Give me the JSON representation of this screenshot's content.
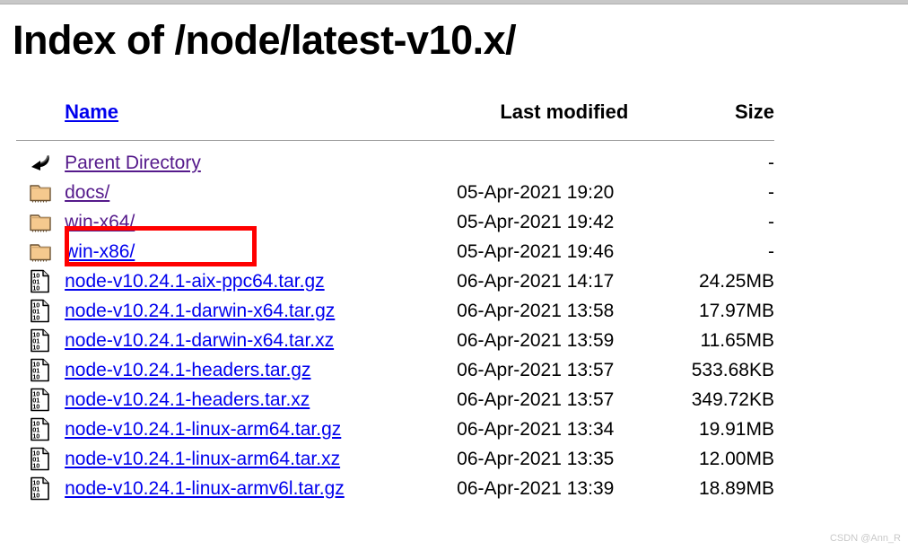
{
  "page": {
    "title": "Index of /node/latest-v10.x/"
  },
  "table": {
    "headers": {
      "name": "Name",
      "last_modified": "Last modified",
      "size": "Size"
    },
    "rows": [
      {
        "icon": "back-arrow-icon",
        "name": "Parent Directory",
        "date": "",
        "size": "-",
        "visited": true
      },
      {
        "icon": "folder-icon",
        "name": "docs/",
        "date": "05-Apr-2021 19:20",
        "size": "-",
        "visited": true
      },
      {
        "icon": "folder-icon",
        "name": "win-x64/",
        "date": "05-Apr-2021 19:42",
        "size": "-",
        "visited": true
      },
      {
        "icon": "folder-icon",
        "name": "win-x86/",
        "date": "05-Apr-2021 19:46",
        "size": "-",
        "visited": false
      },
      {
        "icon": "binary-file-icon",
        "name": "node-v10.24.1-aix-ppc64.tar.gz",
        "date": "06-Apr-2021 14:17",
        "size": "24.25MB",
        "visited": false
      },
      {
        "icon": "binary-file-icon",
        "name": "node-v10.24.1-darwin-x64.tar.gz",
        "date": "06-Apr-2021 13:58",
        "size": "17.97MB",
        "visited": false
      },
      {
        "icon": "binary-file-icon",
        "name": "node-v10.24.1-darwin-x64.tar.xz",
        "date": "06-Apr-2021 13:59",
        "size": "11.65MB",
        "visited": false
      },
      {
        "icon": "binary-file-icon",
        "name": "node-v10.24.1-headers.tar.gz",
        "date": "06-Apr-2021 13:57",
        "size": "533.68KB",
        "visited": false
      },
      {
        "icon": "binary-file-icon",
        "name": "node-v10.24.1-headers.tar.xz",
        "date": "06-Apr-2021 13:57",
        "size": "349.72KB",
        "visited": false
      },
      {
        "icon": "binary-file-icon",
        "name": "node-v10.24.1-linux-arm64.tar.gz",
        "date": "06-Apr-2021 13:34",
        "size": "19.91MB",
        "visited": false
      },
      {
        "icon": "binary-file-icon",
        "name": "node-v10.24.1-linux-arm64.tar.xz",
        "date": "06-Apr-2021 13:35",
        "size": "12.00MB",
        "visited": false
      },
      {
        "icon": "binary-file-icon",
        "name": "node-v10.24.1-linux-armv6l.tar.gz",
        "date": "06-Apr-2021 13:39",
        "size": "18.89MB",
        "visited": false
      }
    ]
  },
  "annotation": {
    "highlight_color": "#FF0000",
    "target_row_name": "win-x64/"
  },
  "watermark": {
    "text": "CSDN @Ann_R"
  },
  "colors": {
    "link_unvisited": "#0000EE",
    "link_visited": "#551A8B",
    "rule": "#9a9a9a",
    "folder_fill": "#F5C98E",
    "watermark": "#c9c9c9"
  }
}
